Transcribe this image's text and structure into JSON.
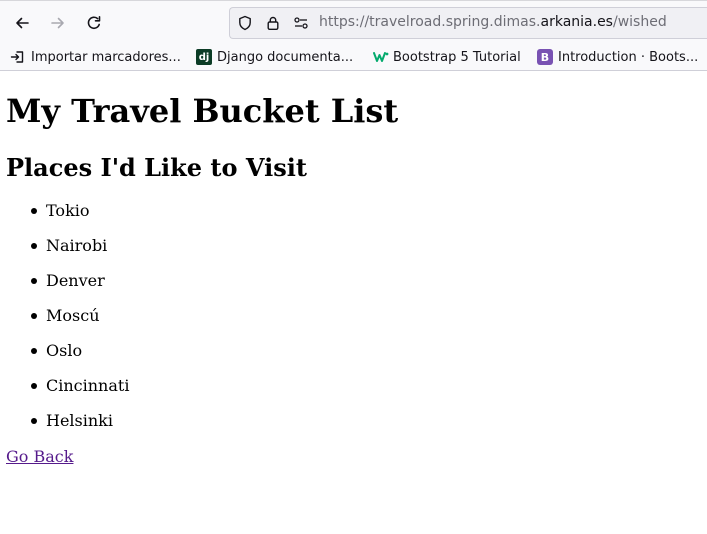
{
  "browser": {
    "url_prefix": "https://travelroad.spring.dimas.",
    "url_domain": "arkania.es",
    "url_path": "/wished",
    "bookmarks": [
      {
        "label": "Importar marcadores..."
      },
      {
        "label": "Django documenta..."
      },
      {
        "label": "Bootstrap 5 Tutorial"
      },
      {
        "label": "Introduction · Boots..."
      }
    ]
  },
  "page": {
    "title": "My Travel Bucket List",
    "subtitle": "Places I'd Like to Visit",
    "places": [
      "Tokio",
      "Nairobi",
      "Denver",
      "Moscú",
      "Oslo",
      "Cincinnati",
      "Helsinki"
    ],
    "back_link": "Go Back"
  },
  "colors": {
    "toolbar_bg": "#f9f9fb",
    "visited_link": "#551a8b",
    "django_icon": "#0c3c26",
    "bootstrap_icon": "#7952b3",
    "w3schools_icon": "#04aa6d"
  },
  "icons": {
    "back": "back-arrow-icon",
    "forward": "forward-arrow-icon",
    "reload": "reload-icon",
    "shield": "shield-icon",
    "lock": "lock-icon",
    "permissions": "permissions-icon",
    "import": "import-bookmarks-icon",
    "django": "django-icon",
    "w3schools": "w3schools-icon",
    "bootstrap": "bootstrap-icon"
  }
}
